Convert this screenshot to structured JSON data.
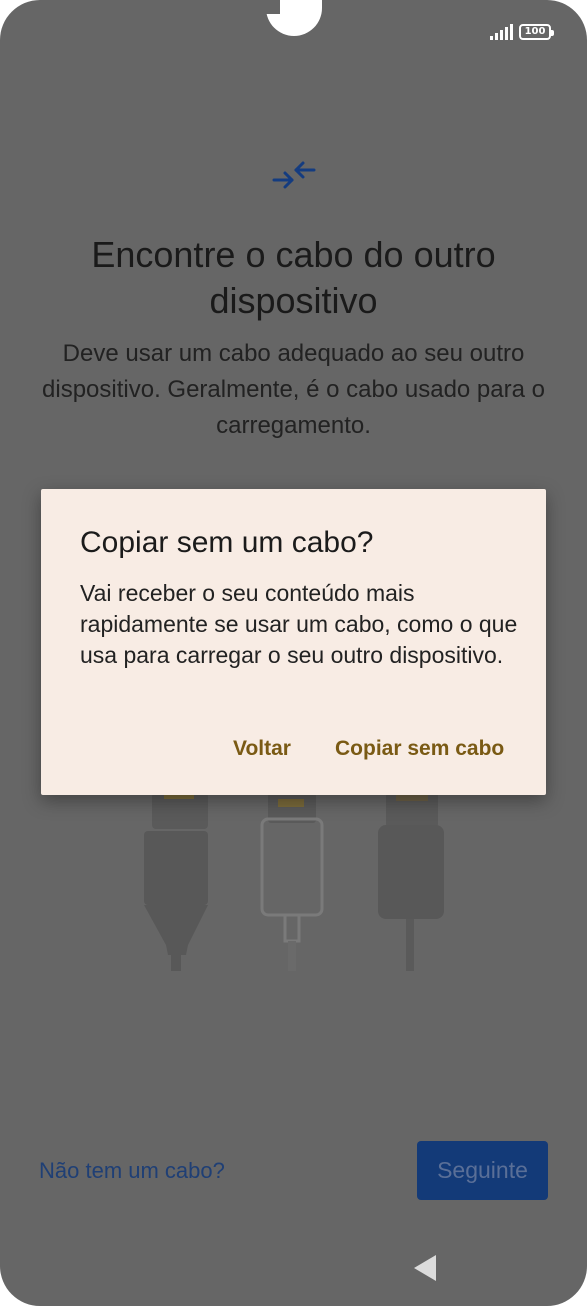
{
  "status_bar": {
    "battery_level": "100",
    "icons": [
      "signal-icon",
      "battery-icon"
    ]
  },
  "screen": {
    "icon": "swap-arrows-icon",
    "title": "Encontre o cabo do outro dispositivo",
    "description": "Deve usar um cabo adequado ao seu outro dispositivo. Geralmente, é o cabo usado para o carregamento.",
    "illustration": "cables-illustration",
    "no_cable_link": "Não tem um cabo?",
    "next_button": "Seguinte"
  },
  "dialog": {
    "title": "Copiar sem um cabo?",
    "body": "Vai receber o seu conteúdo mais rapidamente se usar um cabo, como o que usa para carregar o seu outro dispositivo.",
    "back_button": "Voltar",
    "copy_button": "Copiar sem cabo"
  },
  "navigation": {
    "back_icon": "back-triangle-icon"
  },
  "colors": {
    "scrim": "#666666",
    "dialog_bg": "#f8ece4",
    "dialog_button": "#7a5a14",
    "link": "#1f3f75",
    "primary_button": "#133a78",
    "icon_accent": "#143c80"
  }
}
